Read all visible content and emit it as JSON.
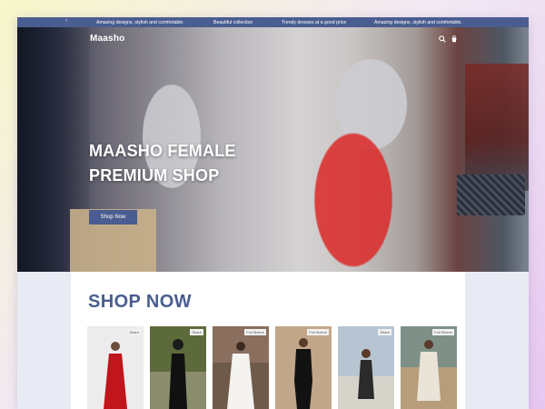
{
  "announcement_bar": {
    "messages": [
      "Amazing designs, stylish and comfortable.",
      "Beautiful collection",
      "Trendy dresses at a good price",
      "Amazing designs, stylish and comfortable."
    ]
  },
  "header": {
    "brand": "Maasho"
  },
  "hero": {
    "title_line1": "MAASHO FEMALE",
    "title_line2": "PREMIUM SHOP",
    "cta_label": "Shop Now"
  },
  "shop": {
    "heading": "SHOP NOW",
    "products": [
      {
        "badge": "Share",
        "bg": "#ececec",
        "dress": "#c0151a"
      },
      {
        "badge": "Share",
        "bg": "#5d6b3c",
        "dress": "#111111"
      },
      {
        "badge": "Full Sleeve",
        "bg": "#8a6f5e",
        "dress": "#f4f3ef"
      },
      {
        "badge": "Full Sleeve",
        "bg": "#c2a689",
        "dress": "#121212"
      },
      {
        "badge": "Share",
        "bg": "#b7c5d2",
        "dress": "#2b2b2b"
      },
      {
        "badge": "Full Sleeve",
        "bg": "#7e9088",
        "dress": "#e9e3d8"
      }
    ]
  },
  "colors": {
    "brand_blue": "#4a5d90",
    "white": "#ffffff"
  }
}
